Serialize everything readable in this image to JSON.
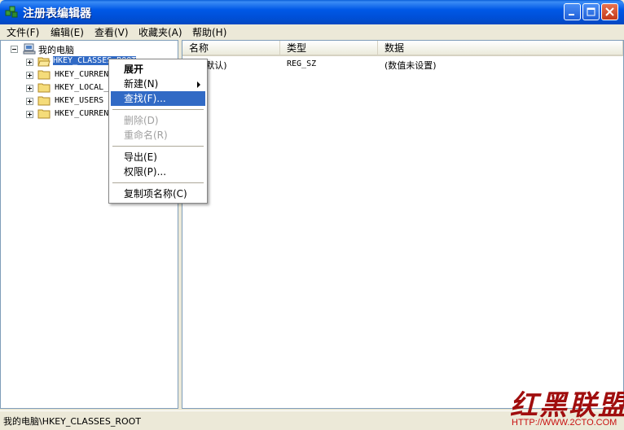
{
  "window": {
    "title": "注册表编辑器"
  },
  "menubar": {
    "items": [
      "文件(F)",
      "编辑(E)",
      "查看(V)",
      "收藏夹(A)",
      "帮助(H)"
    ]
  },
  "tree": {
    "root": "我的电脑",
    "nodes": [
      "HKEY_CLASSES_ROOT",
      "HKEY_CURREN",
      "HKEY_LOCAL_",
      "HKEY_USERS",
      "HKEY_CURREN"
    ],
    "selected_index": 0
  },
  "list": {
    "columns": [
      "名称",
      "类型",
      "数据"
    ],
    "rows": [
      {
        "name": "(默认)",
        "type": "REG_SZ",
        "data": "(数值未设置)"
      }
    ]
  },
  "context_menu": {
    "items": [
      {
        "label": "展开",
        "state": "bold"
      },
      {
        "label": "新建(N)",
        "state": "submenu"
      },
      {
        "label": "查找(F)...",
        "state": "highlighted"
      },
      {
        "label": "删除(D)",
        "state": "disabled"
      },
      {
        "label": "重命名(R)",
        "state": "disabled"
      },
      {
        "label": "导出(E)",
        "state": "normal"
      },
      {
        "label": "权限(P)...",
        "state": "normal"
      },
      {
        "label": "复制项名称(C)",
        "state": "normal"
      }
    ]
  },
  "statusbar": {
    "path": "我的电脑\\HKEY_CLASSES_ROOT"
  },
  "watermark": {
    "text": "红黑联盟",
    "url": "HTTP://WWW.2CTO.COM"
  },
  "icons": {
    "app": "registry-editor-icon",
    "computer": "computer-icon",
    "folder": "folder-icon"
  },
  "colors": {
    "titlebar": "#0058e6",
    "selection": "#316ac5",
    "watermark": "#a00e0e"
  }
}
